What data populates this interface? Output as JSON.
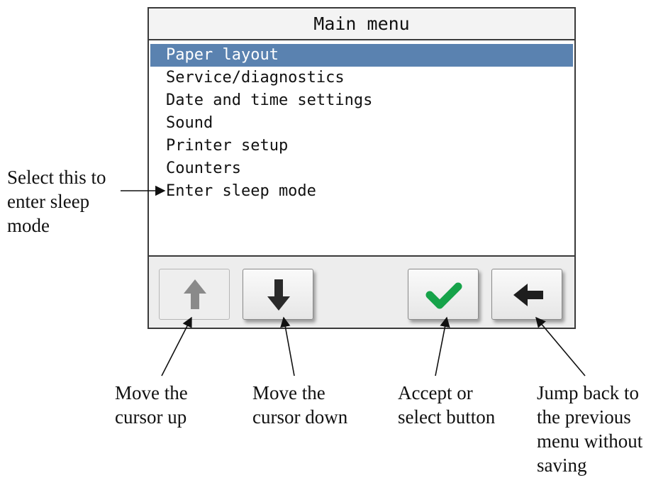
{
  "screen": {
    "title": "Main menu",
    "menu_items": [
      "Paper layout",
      "Service/diagnostics",
      "Date and time settings",
      "Sound",
      "Printer setup",
      "Counters",
      "Enter sleep mode"
    ],
    "selected_index": 0,
    "buttons": {
      "up": {
        "icon": "arrow-up-icon",
        "enabled": false,
        "color": "#8a8a8a"
      },
      "down": {
        "icon": "arrow-down-icon",
        "enabled": true,
        "color": "#2a2a2a"
      },
      "accept": {
        "icon": "checkmark-icon",
        "enabled": true,
        "color": "#16a34a"
      },
      "back": {
        "icon": "arrow-left-icon",
        "enabled": true,
        "color": "#1e1e1e"
      }
    },
    "colors": {
      "selection": "#5a82b0",
      "frame": "#3a3a3a",
      "button_bar": "#ededed"
    }
  },
  "callouts": {
    "sleep": [
      "Select this to",
      "enter sleep",
      "mode"
    ],
    "up": [
      "Move the",
      "cursor up"
    ],
    "down": [
      "Move the",
      "cursor down"
    ],
    "accept": [
      "Accept or",
      "select button"
    ],
    "back": [
      "Jump back to",
      "the previous",
      "menu without",
      "saving"
    ]
  }
}
